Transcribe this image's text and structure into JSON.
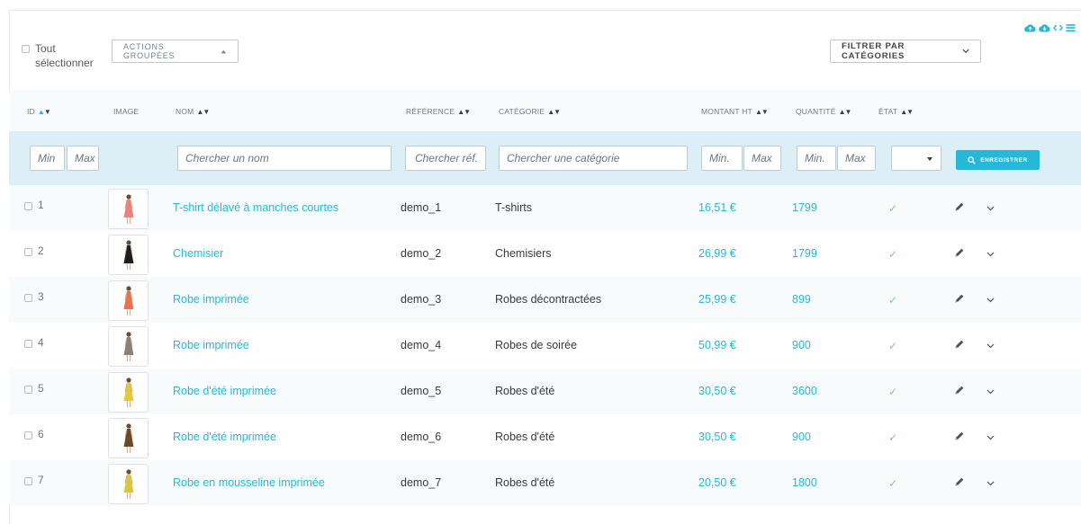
{
  "toolbar": {
    "select_all_label": "Tout\nsélectionner",
    "bulk_actions_label": "ACTIONS GROUPÉES",
    "filter_categories_label": "FILTRER PAR CATÉGORIES"
  },
  "top_icons": [
    "cloud-upload-icon",
    "cloud-download-icon",
    "code-icon",
    "menu-icon"
  ],
  "columns": {
    "id": "ID",
    "image": "IMAGE",
    "name": "NOM",
    "reference": "RÉFÉRENCE",
    "category": "CATÉGORIE",
    "price": "MONTANT HT",
    "quantity": "QUANTITÉ",
    "status": "ÉTAT"
  },
  "filters": {
    "id_min": "Min",
    "id_max": "Max",
    "name": "Chercher un nom",
    "reference": "Chercher réf.",
    "category": "Chercher une catégorie",
    "price_min": "Min.",
    "price_max": "Max",
    "qty_min": "Min.",
    "qty_max": "Max",
    "save_label": "ENREGISTRER"
  },
  "colors": {
    "accent": "#25b9d7",
    "check": "#78d07d",
    "filter_bg": "#dceff6"
  },
  "products": [
    {
      "id": "1",
      "name": "T-shirt délavé à manches courtes",
      "reference": "demo_1",
      "category": "T-shirts",
      "price": "16,51 €",
      "quantity": "1799",
      "status": "✓",
      "dress": "#e9827a"
    },
    {
      "id": "2",
      "name": "Chemisier",
      "reference": "demo_2",
      "category": "Chemisiers",
      "price": "26,99 €",
      "quantity": "1799",
      "status": "✓",
      "dress": "#1e1e1e"
    },
    {
      "id": "3",
      "name": "Robe imprimée",
      "reference": "demo_3",
      "category": "Robes décontractées",
      "price": "25,99 €",
      "quantity": "899",
      "status": "✓",
      "dress": "#e8734f"
    },
    {
      "id": "4",
      "name": "Robe imprimée",
      "reference": "demo_4",
      "category": "Robes de soirée",
      "price": "50,99 €",
      "quantity": "900",
      "status": "✓",
      "dress": "#8a8078"
    },
    {
      "id": "5",
      "name": "Robe d'été imprimée",
      "reference": "demo_5",
      "category": "Robes d'été",
      "price": "30,50 €",
      "quantity": "3600",
      "status": "✓",
      "dress": "#e3c83a"
    },
    {
      "id": "6",
      "name": "Robe d'été imprimée",
      "reference": "demo_6",
      "category": "Robes d'été",
      "price": "30,50 €",
      "quantity": "900",
      "status": "✓",
      "dress": "#6b4a2a"
    },
    {
      "id": "7",
      "name": "Robe en mousseline imprimée",
      "reference": "demo_7",
      "category": "Robes d'été",
      "price": "20,50 €",
      "quantity": "1800",
      "status": "✓",
      "dress": "#d9c83e"
    }
  ]
}
